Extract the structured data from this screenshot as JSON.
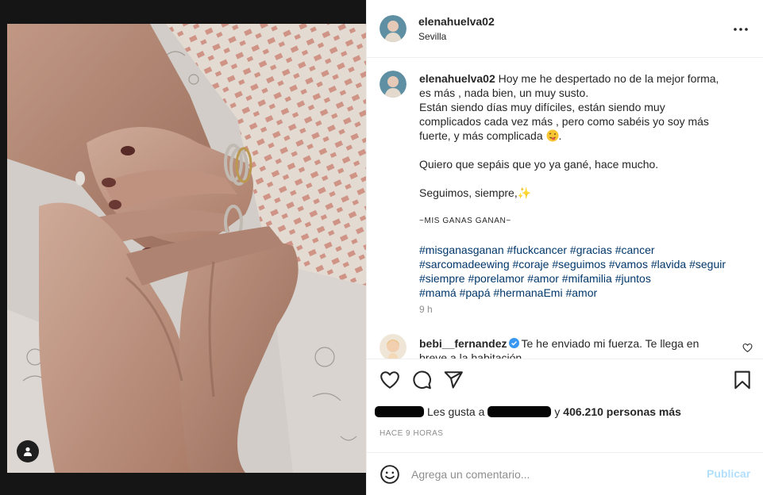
{
  "post": {
    "username": "elenahuelva02",
    "location": "Sevilla",
    "more_icon": "more-horizontal-icon"
  },
  "caption": {
    "username": "elenahuelva02",
    "line1": "Hoy me he despertado no de la mejor forma,",
    "line2": "es más , nada bien, un muy susto.",
    "line3": "Están siendo días muy difíciles, están siendo muy",
    "line4": "complicados cada vez más , pero como sabéis yo soy más",
    "line5": "fuerte, y más complicada",
    "line5_emoji": "winking-face-tongue-emoji",
    "line6": "Quiero que sepáis que yo ya gané, hace mucho.",
    "line7": "Seguimos, siempre,",
    "line7_emoji": "sparkles-emoji",
    "line8": "~MIS GANAS GANAN~",
    "hashtags": [
      [
        "#misganasganan",
        "#fuckcancer",
        "#gracias",
        "#cancer"
      ],
      [
        "#sarcomadeewing",
        "#coraje",
        "#seguimos",
        "#vamos",
        "#lavida",
        "#seguir"
      ],
      [
        "#siempre",
        "#porelamor",
        "#amor",
        "#mifamilia",
        "#juntos"
      ],
      [
        "#mamá",
        "#papá",
        "#hermanaEmi",
        "#amor"
      ]
    ],
    "time": "9 h"
  },
  "comment": {
    "username": "bebi__fernandez",
    "verified": true,
    "text": "Te he enviado mi fuerza. Te llega en",
    "text_cont": "breve a la habitación"
  },
  "actions": {
    "like_icon": "heart-icon",
    "comment_icon": "comment-bubble-icon",
    "share_icon": "paper-plane-icon",
    "save_icon": "bookmark-icon"
  },
  "likes": {
    "prefix": "Les gusta a",
    "middle": "y",
    "count": "406.210 personas más"
  },
  "timestamp": "HACE 9 HORAS",
  "add_comment": {
    "placeholder": "Agrega un comentario...",
    "publish_label": "Publicar",
    "emoji_icon": "smiley-icon"
  },
  "colors": {
    "hashtag": "#00376b",
    "publish_disabled": "#b2dffc",
    "verified": "#3897f0",
    "muted": "#8e8e8e"
  }
}
